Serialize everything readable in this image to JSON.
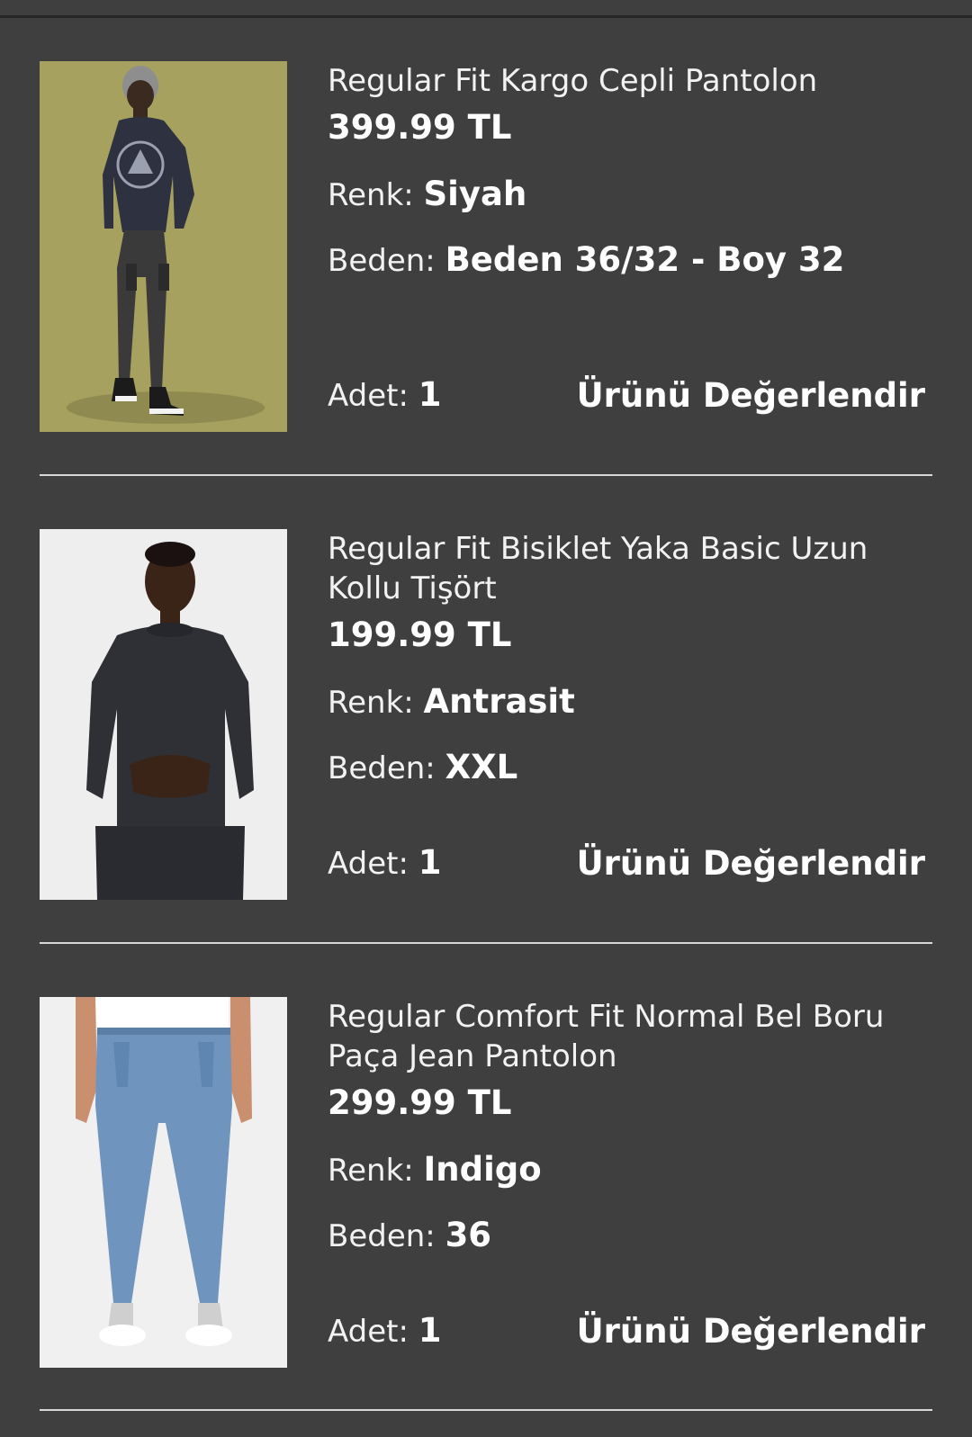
{
  "colors": {
    "background": "#3f3f3f",
    "text": "#ffffff",
    "divider": "#d8d8d8"
  },
  "labels": {
    "color": "Renk:",
    "size": "Beden:",
    "quantity": "Adet:",
    "rate": "Ürünü Değerlendir"
  },
  "items": [
    {
      "name": "Regular Fit Kargo Cepli Pantolon",
      "price": "399.99 TL",
      "color": "Siyah",
      "size": "Beden 36/32 - Boy 32",
      "quantity": "1"
    },
    {
      "name": "Regular Fit Bisiklet Yaka Basic Uzun Kollu Tişört",
      "price": "199.99 TL",
      "color": "Antrasit",
      "size": "XXL",
      "quantity": "1"
    },
    {
      "name": "Regular Comfort Fit Normal Bel Boru Paça Jean Pantolon",
      "price": "299.99 TL",
      "color": "Indigo",
      "size": "36",
      "quantity": "1"
    }
  ]
}
